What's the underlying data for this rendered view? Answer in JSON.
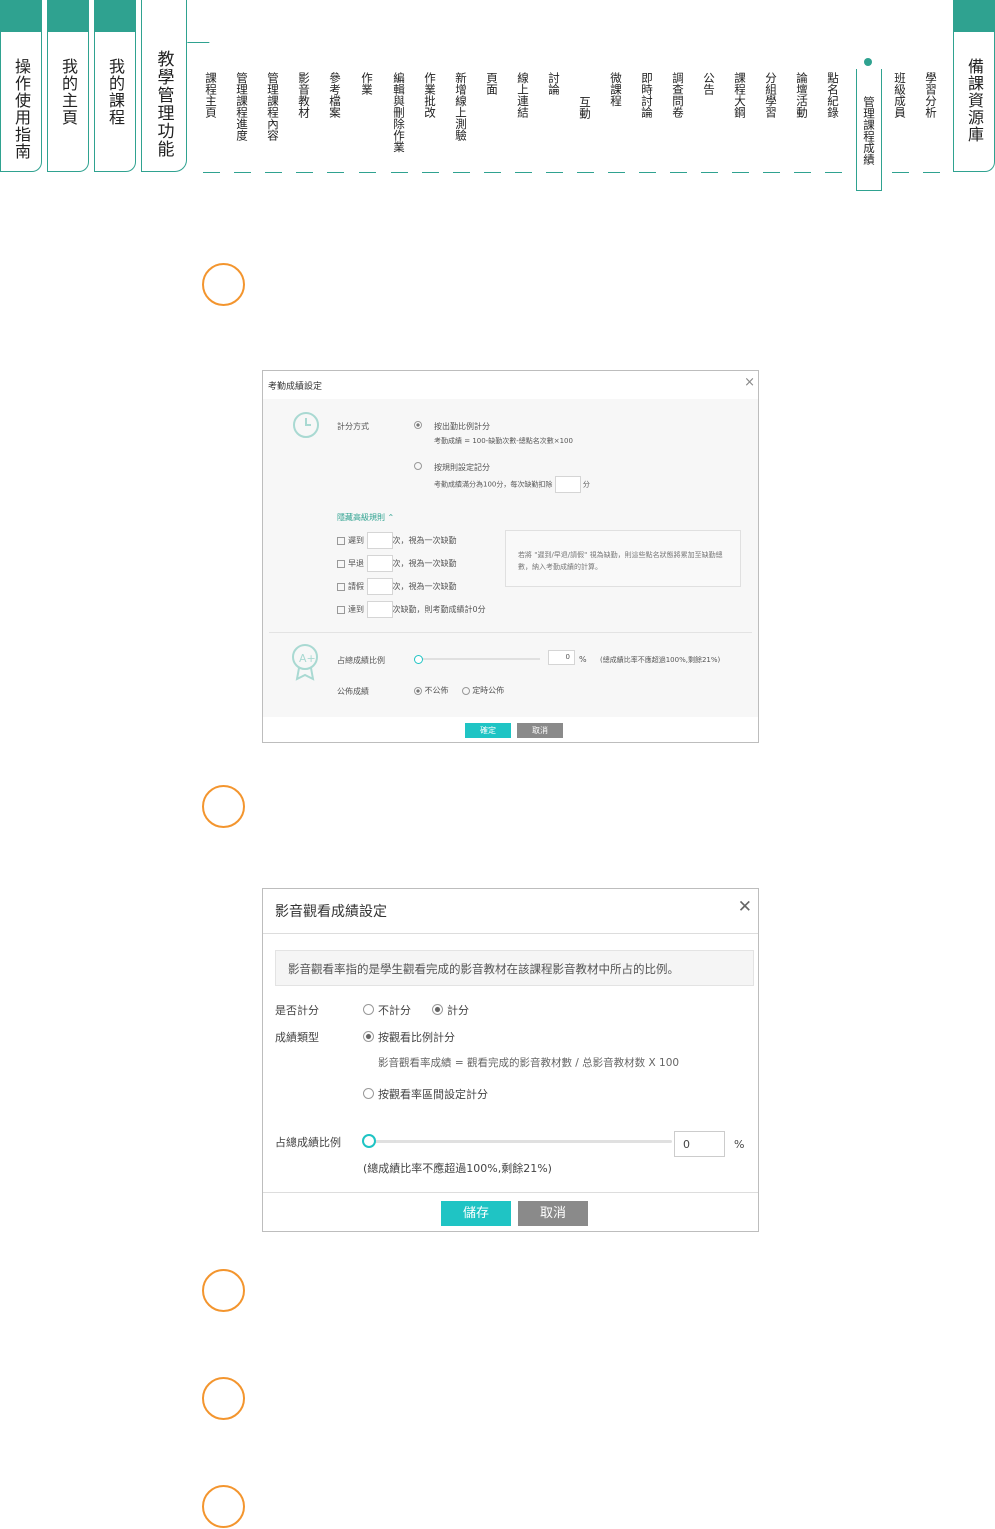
{
  "tabs": {
    "guide": "操作使用指南",
    "home": "我的主頁",
    "courses": "我的課程",
    "teaching": "教學管理功能",
    "resources": "備課資源庫"
  },
  "subtabs": [
    "課程主頁",
    "管理課程進度",
    "管理課程內容",
    "影音教材",
    "參考檔案",
    "作業",
    "編輯與刪除作業",
    "作業批改",
    "新增線上測驗",
    "頁面",
    "線上連結",
    "討論",
    "互動",
    "微課程",
    "即時討論",
    "調查問卷",
    "公告",
    "課程大鋼",
    "分組學習",
    "論壇活動",
    "點名紀錄",
    "管理課程成績",
    "班級成員",
    "學習分析"
  ],
  "dialog1": {
    "title": "考勤成績設定",
    "close": "×",
    "scoring_label": "計分方式",
    "option1": "按出勤比例計分",
    "option1_formula": "考勤成績 = 100-缺勤次數-總點名次數×100",
    "option2": "按規則設定記分",
    "option2_text": "考勤成績滿分為100分，每次缺勤扣除",
    "option2_unit": "分",
    "advanced": "隱藏高級規則 ⌃",
    "rule1_label": "遲到",
    "rule1_suffix": "次，視為一次缺勤",
    "rule2_label": "早退",
    "rule2_suffix": "次，視為一次缺勤",
    "rule3_label": "請假",
    "rule3_suffix": "次，視為一次缺勤",
    "rule4_label": "達到",
    "rule4_suffix": "次缺勤，則考勤成績計0分",
    "note": "若將 \"遲到/早退/請假\" 視為缺勤，則這些點名狀態將累加至缺勤總數，納入考勤成績的計算。",
    "ratio_label": "占總成績比例",
    "ratio_value": "0",
    "ratio_unit": "%",
    "ratio_hint": "(總成績比率不應超過100%,剩餘21%)",
    "publish_label": "公佈成績",
    "publish_opt1": "不公佈",
    "publish_opt2": "定時公佈",
    "confirm": "確定",
    "cancel": "取消"
  },
  "dialog2": {
    "title": "影音觀看成績設定",
    "close": "✕",
    "info": "影音觀看率指的是學生觀看完成的影音教材在該課程影音教材中所占的比例。",
    "score_label": "是否計分",
    "no_score": "不計分",
    "yes_score": "計分",
    "type_label": "成績類型",
    "type1": "按觀看比例計分",
    "formula": "影音觀看率成績 = 觀看完成的影音教材數 / 总影音教材数 X 100",
    "type2": "按觀看率區間設定計分",
    "ratio_label": "占總成績比例",
    "ratio_value": "0",
    "ratio_unit": "%",
    "ratio_hint": "(總成績比率不應超過100%,剩餘21%)",
    "save": "儲存",
    "cancel": "取消"
  },
  "colors": {
    "teal": "#2fa290",
    "accent_button": "#1fc4c4",
    "gray_button": "#8a8a8a",
    "step_circle": "#f3952e"
  }
}
